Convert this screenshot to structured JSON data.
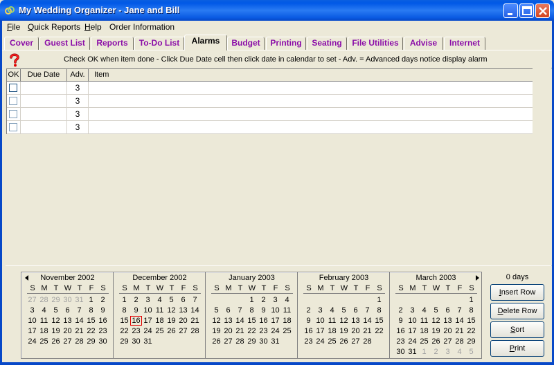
{
  "window": {
    "title": "My Wedding Organizer - Jane and Bill"
  },
  "menu": [
    {
      "label": "File",
      "underline": "F",
      "rest": "ile"
    },
    {
      "label": "Quick Reports",
      "underline": "Q",
      "rest": "uick Reports"
    },
    {
      "label": "Help",
      "underline": "H",
      "rest": "elp"
    },
    {
      "label": "Order Information",
      "underline": "",
      "rest": "Order Information"
    }
  ],
  "tabs": [
    {
      "label": "Cover"
    },
    {
      "label": "Guest List"
    },
    {
      "label": "Reports"
    },
    {
      "label": "To-Do List"
    },
    {
      "label": "Alarms",
      "active": true
    },
    {
      "label": "Budget"
    },
    {
      "label": "Printing"
    },
    {
      "label": "Seating"
    },
    {
      "label": "File Utilities"
    },
    {
      "label": "Advise"
    },
    {
      "label": "Internet"
    }
  ],
  "instructions": "Check OK when item done  -  Click Due Date cell then click date in calendar to set  -  Adv. = Advanced days notice display alarm",
  "grid": {
    "columns": [
      "OK",
      "Due Date",
      "Adv.",
      "Item"
    ],
    "rows": [
      {
        "ok": false,
        "due": "",
        "adv": "3",
        "item": ""
      },
      {
        "ok": false,
        "due": "",
        "adv": "3",
        "item": ""
      },
      {
        "ok": false,
        "due": "",
        "adv": "3",
        "item": ""
      },
      {
        "ok": false,
        "due": "",
        "adv": "3",
        "item": ""
      }
    ]
  },
  "calendar": {
    "dow": [
      "S",
      "M",
      "T",
      "W",
      "T",
      "F",
      "S"
    ],
    "today": {
      "month": 1,
      "day": "16"
    },
    "months": [
      {
        "title": "November 2002",
        "weeks": [
          [
            "27",
            "28",
            "29",
            "30",
            "31",
            "1",
            "2"
          ],
          [
            "3",
            "4",
            "5",
            "6",
            "7",
            "8",
            "9"
          ],
          [
            "10",
            "11",
            "12",
            "13",
            "14",
            "15",
            "16"
          ],
          [
            "17",
            "18",
            "19",
            "20",
            "21",
            "22",
            "23"
          ],
          [
            "24",
            "25",
            "26",
            "27",
            "28",
            "29",
            "30"
          ]
        ],
        "grey_leading": 5,
        "grey_trailing": 0
      },
      {
        "title": "December 2002",
        "weeks": [
          [
            "1",
            "2",
            "3",
            "4",
            "5",
            "6",
            "7"
          ],
          [
            "8",
            "9",
            "10",
            "11",
            "12",
            "13",
            "14"
          ],
          [
            "15",
            "16",
            "17",
            "18",
            "19",
            "20",
            "21"
          ],
          [
            "22",
            "23",
            "24",
            "25",
            "26",
            "27",
            "28"
          ],
          [
            "29",
            "30",
            "31",
            "",
            "",
            "",
            ""
          ]
        ],
        "grey_leading": 0,
        "grey_trailing": 0
      },
      {
        "title": "January 2003",
        "weeks": [
          [
            "",
            "",
            "",
            "1",
            "2",
            "3",
            "4"
          ],
          [
            "5",
            "6",
            "7",
            "8",
            "9",
            "10",
            "11"
          ],
          [
            "12",
            "13",
            "14",
            "15",
            "16",
            "17",
            "18"
          ],
          [
            "19",
            "20",
            "21",
            "22",
            "23",
            "24",
            "25"
          ],
          [
            "26",
            "27",
            "28",
            "29",
            "30",
            "31",
            ""
          ]
        ],
        "grey_leading": 0,
        "grey_trailing": 0
      },
      {
        "title": "February 2003",
        "weeks": [
          [
            "",
            "",
            "",
            "",
            "",
            "",
            "1"
          ],
          [
            "2",
            "3",
            "4",
            "5",
            "6",
            "7",
            "8"
          ],
          [
            "9",
            "10",
            "11",
            "12",
            "13",
            "14",
            "15"
          ],
          [
            "16",
            "17",
            "18",
            "19",
            "20",
            "21",
            "22"
          ],
          [
            "23",
            "24",
            "25",
            "26",
            "27",
            "28",
            ""
          ]
        ],
        "grey_leading": 0,
        "grey_trailing": 0
      },
      {
        "title": "March 2003",
        "weeks": [
          [
            "",
            "",
            "",
            "",
            "",
            "",
            "1"
          ],
          [
            "2",
            "3",
            "4",
            "5",
            "6",
            "7",
            "8"
          ],
          [
            "9",
            "10",
            "11",
            "12",
            "13",
            "14",
            "15"
          ],
          [
            "16",
            "17",
            "18",
            "19",
            "20",
            "21",
            "22"
          ],
          [
            "23",
            "24",
            "25",
            "26",
            "27",
            "28",
            "29"
          ],
          [
            "30",
            "31",
            "1",
            "2",
            "3",
            "4",
            "5"
          ]
        ],
        "grey_leading": 0,
        "grey_trailing": 5
      }
    ]
  },
  "side": {
    "days_label": "0 days",
    "buttons": [
      {
        "name": "insert-row-button",
        "underline": "I",
        "rest": "nsert Row"
      },
      {
        "name": "delete-row-button",
        "underline": "D",
        "rest": "elete Row"
      },
      {
        "name": "sort-button",
        "underline": "S",
        "rest": "ort"
      },
      {
        "name": "print-button",
        "underline": "P",
        "rest": "rint"
      }
    ]
  },
  "colors": {
    "tab_text": "#8b0ea8",
    "today_outline": "#e00000",
    "titlebar": "#0058e6"
  },
  "icons": {
    "app": "wedding-rings-icon",
    "help": "question-mark-icon",
    "prev": "triangle-left-icon",
    "next": "triangle-right-icon"
  }
}
